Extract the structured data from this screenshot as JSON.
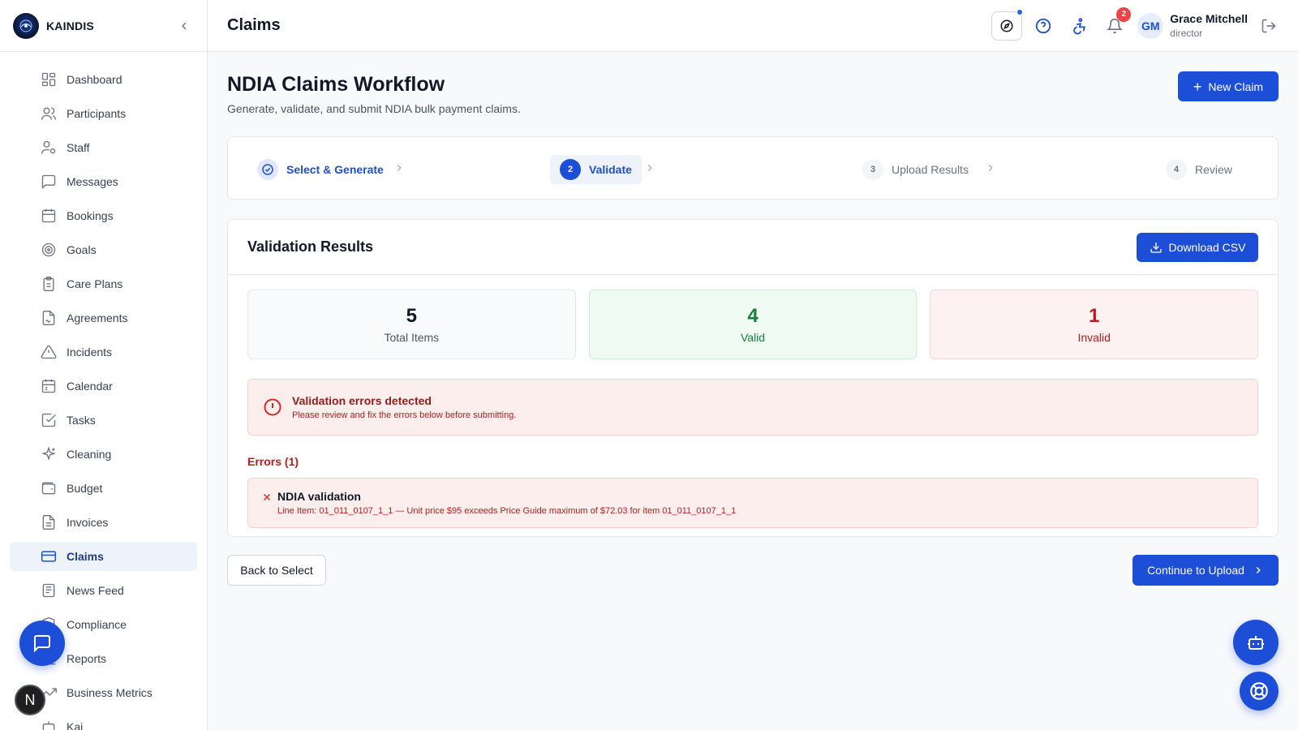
{
  "app": {
    "name": "KAINDIS"
  },
  "topbar": {
    "title": "Claims",
    "notifications_count": "2",
    "user": {
      "initials": "GM",
      "name": "Grace Mitchell",
      "role": "director"
    }
  },
  "sidebar": {
    "items": [
      {
        "label": "Dashboard",
        "icon": "dashboard-icon"
      },
      {
        "label": "Participants",
        "icon": "users-icon"
      },
      {
        "label": "Staff",
        "icon": "user-cog-icon"
      },
      {
        "label": "Messages",
        "icon": "message-icon"
      },
      {
        "label": "Bookings",
        "icon": "calendar-grid-icon"
      },
      {
        "label": "Goals",
        "icon": "target-icon"
      },
      {
        "label": "Care Plans",
        "icon": "clipboard-icon"
      },
      {
        "label": "Agreements",
        "icon": "file-signature-icon"
      },
      {
        "label": "Incidents",
        "icon": "warning-icon"
      },
      {
        "label": "Calendar",
        "icon": "calendar-icon"
      },
      {
        "label": "Tasks",
        "icon": "check-square-icon"
      },
      {
        "label": "Cleaning",
        "icon": "sparkles-icon"
      },
      {
        "label": "Budget",
        "icon": "wallet-icon"
      },
      {
        "label": "Invoices",
        "icon": "file-text-icon"
      },
      {
        "label": "Claims",
        "icon": "credit-card-icon",
        "active": true
      },
      {
        "label": "News Feed",
        "icon": "newspaper-icon"
      },
      {
        "label": "Compliance",
        "icon": "shield-icon"
      },
      {
        "label": "Reports",
        "icon": "bar-chart-icon"
      },
      {
        "label": "Business Metrics",
        "icon": "trending-up-icon"
      },
      {
        "label": "Kai",
        "icon": "bot-icon"
      }
    ]
  },
  "page": {
    "title": "NDIA Claims Workflow",
    "subtitle": "Generate, validate, and submit NDIA bulk payment claims.",
    "new_claim_label": "New Claim"
  },
  "stepper": {
    "steps": [
      {
        "number": "1",
        "label": "Select & Generate",
        "state": "done"
      },
      {
        "number": "2",
        "label": "Validate",
        "state": "active"
      },
      {
        "number": "3",
        "label": "Upload Results",
        "state": "todo"
      },
      {
        "number": "4",
        "label": "Review",
        "state": "todo"
      }
    ]
  },
  "validation": {
    "title": "Validation Results",
    "download_label": "Download CSV",
    "stats": {
      "total": {
        "value": "5",
        "label": "Total Items"
      },
      "valid": {
        "value": "4",
        "label": "Valid"
      },
      "invalid": {
        "value": "1",
        "label": "Invalid"
      }
    },
    "alert": {
      "title": "Validation errors detected",
      "message": "Please review and fix the errors below before submitting."
    },
    "errors_heading": "Errors (1)",
    "errors": [
      {
        "title": "NDIA validation",
        "message": "Line Item: 01_011_0107_1_1 — Unit price $95 exceeds Price Guide maximum of $72.03 for item 01_011_0107_1_1"
      }
    ]
  },
  "actions": {
    "back_label": "Back to Select",
    "continue_label": "Continue to Upload"
  },
  "floating": {
    "n_badge": "N"
  },
  "colors": {
    "accent": "#1d4ed8",
    "success": "#15803d",
    "danger": "#b91c1c"
  }
}
